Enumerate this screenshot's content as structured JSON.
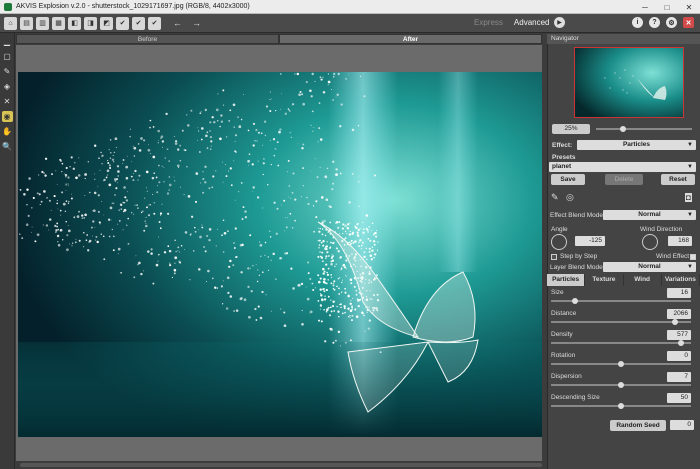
{
  "window": {
    "title": "AKVIS Explosion v.2.0 - shutterstock_1029171697.jpg (RGB/8, 4402x3000)",
    "controls": [
      "─",
      "□",
      "✕"
    ]
  },
  "toolbar": {
    "icons": [
      "home-icon",
      "open-icon",
      "save-icon",
      "print-icon",
      "share-icon",
      "batch-icon",
      "compare-icon",
      "preferences-icon",
      "presets-icon",
      "undo-icon",
      "redo-icon"
    ],
    "undo": "←",
    "redo": "→"
  },
  "modes": {
    "express": "Express",
    "advanced": "Advanced"
  },
  "right_tools": {
    "run": "▶",
    "info": "i",
    "help": "?",
    "settings": "⚙",
    "close": "✕"
  },
  "view_tabs": {
    "before": "Before",
    "after": "After"
  },
  "left_tools": [
    "▁",
    "▢",
    "✎",
    "◈",
    "✕",
    "◉",
    "✋",
    "🔍"
  ],
  "navigator": {
    "title": "Navigator",
    "zoom": "25%"
  },
  "effect": {
    "label": "Effect:",
    "value": "Particles"
  },
  "presets": {
    "label": "Presets",
    "value": "planet",
    "save": "Save",
    "delete": "Delete",
    "reset": "Reset"
  },
  "blend": {
    "effect_label": "Effect Blend Mode",
    "effect_value": "Normal",
    "layer_label": "Layer Blend Mode",
    "layer_value": "Normal"
  },
  "angle": {
    "label": "Angle",
    "value": "-125"
  },
  "wind_direction": {
    "label": "Wind Direction",
    "value": "168"
  },
  "step_by_step": {
    "label": "Step by Step",
    "checked": false
  },
  "wind_effect": {
    "label": "Wind Effect",
    "checked": true
  },
  "param_tabs": [
    "Particles",
    "Texture",
    "Wind",
    "Variations"
  ],
  "params": [
    {
      "label": "Size",
      "value": "16",
      "level": 0.16
    },
    {
      "label": "Distance",
      "value": "2066",
      "level": 0.9
    },
    {
      "label": "Density",
      "value": "577",
      "level": 0.95
    },
    {
      "label": "Rotation",
      "value": "0",
      "level": 0.5
    },
    {
      "label": "Dispersion",
      "value": "7",
      "level": 0.5
    },
    {
      "label": "Descending Size",
      "value": "50",
      "level": 0.5
    }
  ],
  "random_seed": {
    "label": "Random Seed",
    "value": "0"
  }
}
